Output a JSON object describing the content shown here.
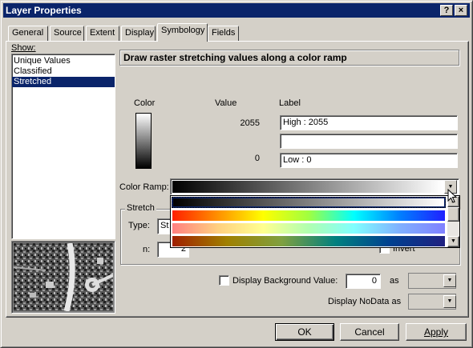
{
  "window": {
    "title": "Layer Properties",
    "help_label": "?",
    "close_label": "×"
  },
  "tabs": [
    "General",
    "Source",
    "Extent",
    "Display",
    "Symbology",
    "Fields"
  ],
  "show": {
    "label": "Show:",
    "items": [
      "Unique Values",
      "Classified",
      "Stretched"
    ],
    "selected_index": 2
  },
  "heading": "Draw raster stretching values along a color ramp",
  "columns": {
    "color": "Color",
    "value": "Value",
    "label": "Label"
  },
  "values": {
    "high_value": "2055",
    "low_value": "0",
    "high_label": "High : 2055",
    "mid_label": "",
    "low_label": "Low : 0"
  },
  "color_ramp": {
    "label": "Color Ramp:",
    "options": [
      {
        "name": "black-to-white",
        "colors": [
          "#000000",
          "#ffffff"
        ]
      },
      {
        "name": "full-spectrum",
        "colors": [
          "#ff2000",
          "#ff9000",
          "#ffff00",
          "#a0ff40",
          "#00ffff",
          "#0080ff",
          "#2020ff"
        ]
      },
      {
        "name": "pastel-spectrum",
        "colors": [
          "#ff8080",
          "#ffd080",
          "#ffff90",
          "#b0ffb0",
          "#80ffff",
          "#80b0ff",
          "#8080ff"
        ]
      },
      {
        "name": "earth-to-sea",
        "colors": [
          "#a02000",
          "#a08000",
          "#80a040",
          "#008080",
          "#004090",
          "#202080"
        ]
      }
    ]
  },
  "stretch": {
    "group_label": "Stretch",
    "type_label": "Type:",
    "type_value": "St",
    "n_label": "n:",
    "n_value": "2",
    "invert_label": "Invert"
  },
  "background": {
    "display_bg_label": "Display Background Value:",
    "bg_value": "0",
    "as_label": "as",
    "nodata_label": "Display NoData as",
    "as2_label": "as"
  },
  "buttons": {
    "ok": "OK",
    "cancel": "Cancel",
    "apply": "Apply"
  }
}
